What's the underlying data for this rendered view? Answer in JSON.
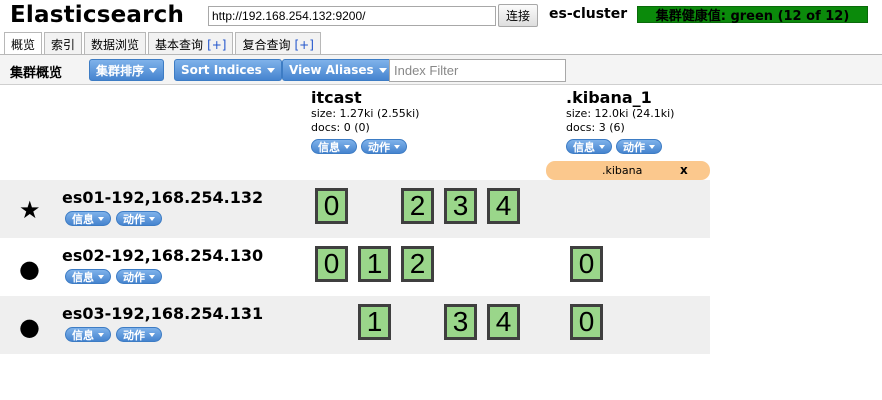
{
  "header": {
    "app_title": "Elasticsearch",
    "url": "http://192.168.254.132:9200/",
    "connect_label": "连接",
    "cluster_name": "es-cluster",
    "health": "集群健康值: green (12 of 12)",
    "health_color": "#0b8a0b"
  },
  "tabs": [
    {
      "label": "概览",
      "plus": ""
    },
    {
      "label": "索引",
      "plus": ""
    },
    {
      "label": "数据浏览",
      "plus": ""
    },
    {
      "label": "基本查询",
      "plus": "[+]"
    },
    {
      "label": "复合查询",
      "plus": "[+]"
    }
  ],
  "toolbar": {
    "label": "集群概览",
    "sort_cluster": "集群排序",
    "sort_indices": "Sort Indices",
    "view_aliases": "View Aliases",
    "filter_placeholder": "Index Filter"
  },
  "indices": [
    {
      "name": "itcast",
      "size": "size: 1.27ki (2.55ki)",
      "docs": "docs: 0 (0)",
      "info": "信息",
      "action": "动作"
    },
    {
      "name": ".kibana_1",
      "size": "size: 12.0ki (24.1ki)",
      "docs": "docs: 3 (6)",
      "info": "信息",
      "action": "动作"
    }
  ],
  "alias": {
    "name": ".kibana",
    "remove": "x",
    "color": "#fbc88d"
  },
  "nodes": [
    {
      "name": "es01-192,168.254.132",
      "icon": "star-icon",
      "master": true,
      "info": "信息",
      "action": "动作",
      "itcast_shards": [
        "0",
        "2",
        "3",
        "4"
      ],
      "kibana_shards": []
    },
    {
      "name": "es02-192,168.254.130",
      "icon": "circle-icon",
      "master": false,
      "info": "信息",
      "action": "动作",
      "itcast_shards": [
        "0",
        "1",
        "2"
      ],
      "kibana_shards": [
        "0"
      ]
    },
    {
      "name": "es03-192,168.254.131",
      "icon": "circle-icon",
      "master": false,
      "info": "信息",
      "action": "动作",
      "itcast_shards": [
        "1",
        "3",
        "4"
      ],
      "kibana_shards": [
        "0"
      ]
    }
  ],
  "colors": {
    "shard_fill": "#9ad68a",
    "button_blue": "#4684cf",
    "row_shade": "#efefef"
  }
}
